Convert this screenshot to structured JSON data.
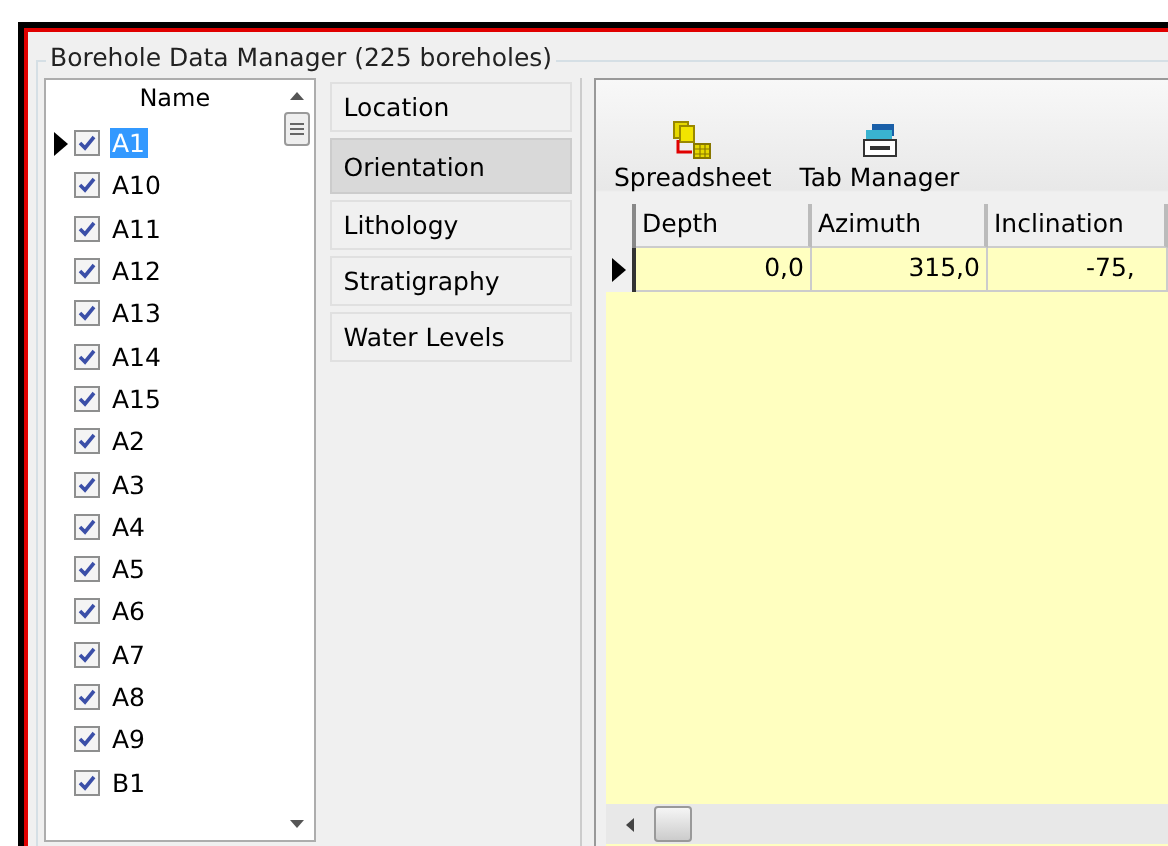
{
  "group_title": "Borehole Data Manager (225 boreholes)",
  "list": {
    "header": "Name",
    "items": [
      {
        "name": "A1",
        "checked": true,
        "selected": true
      },
      {
        "name": "A10",
        "checked": true,
        "selected": false
      },
      {
        "name": "A11",
        "checked": true,
        "selected": false
      },
      {
        "name": "A12",
        "checked": true,
        "selected": false
      },
      {
        "name": "A13",
        "checked": true,
        "selected": false
      },
      {
        "name": "A14",
        "checked": true,
        "selected": false
      },
      {
        "name": "A15",
        "checked": true,
        "selected": false
      },
      {
        "name": "A2",
        "checked": true,
        "selected": false
      },
      {
        "name": "A3",
        "checked": true,
        "selected": false
      },
      {
        "name": "A4",
        "checked": true,
        "selected": false
      },
      {
        "name": "A5",
        "checked": true,
        "selected": false
      },
      {
        "name": "A6",
        "checked": true,
        "selected": false
      },
      {
        "name": "A7",
        "checked": true,
        "selected": false
      },
      {
        "name": "A8",
        "checked": true,
        "selected": false
      },
      {
        "name": "A9",
        "checked": true,
        "selected": false
      },
      {
        "name": "B1",
        "checked": true,
        "selected": false
      }
    ]
  },
  "tabs": [
    {
      "label": "Location",
      "selected": false
    },
    {
      "label": "Orientation",
      "selected": true
    },
    {
      "label": "Lithology",
      "selected": false
    },
    {
      "label": "Stratigraphy",
      "selected": false
    },
    {
      "label": "Water Levels",
      "selected": false
    }
  ],
  "toolbar": [
    {
      "label": "Spreadsheet",
      "kind": "spreadsheet"
    },
    {
      "label": "Tab Manager",
      "kind": "tabs"
    }
  ],
  "grid": {
    "columns": [
      "Depth",
      "Azimuth",
      "Inclination"
    ],
    "rows": [
      {
        "cells": [
          "0,0",
          "315,0",
          "-75,"
        ],
        "selected": true
      }
    ]
  }
}
